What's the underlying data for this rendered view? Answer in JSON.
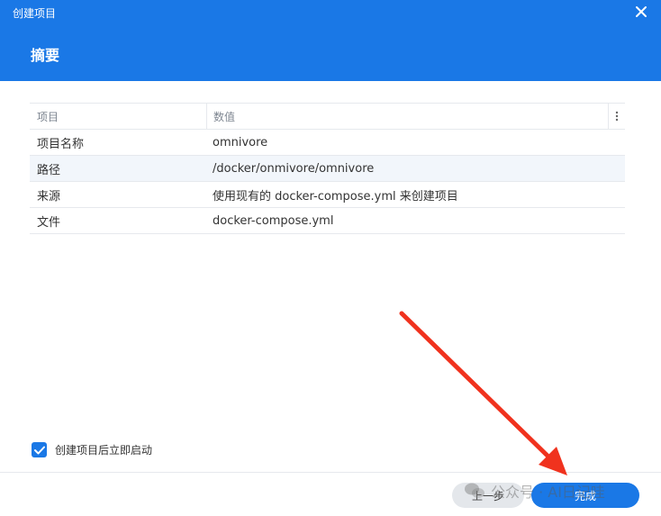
{
  "window": {
    "title": "创建项目",
    "close_icon": "close-icon"
  },
  "step": {
    "title": "摘要"
  },
  "table": {
    "headers": {
      "item": "项目",
      "value": "数值"
    },
    "rows": [
      {
        "item": "项目名称",
        "value": "omnivore"
      },
      {
        "item": "路径",
        "value": "/docker/onmivore/omnivore"
      },
      {
        "item": "来源",
        "value": "使用现有的 docker-compose.yml 来创建项目"
      },
      {
        "item": "文件",
        "value": "docker-compose.yml"
      }
    ]
  },
  "options": {
    "start_after_create_label": "创建项目后立即启动",
    "start_after_create_checked": true
  },
  "footer": {
    "prev_label": "上一步",
    "finish_label": "完成"
  },
  "watermark": {
    "text": "公众号 · AI日记哇"
  },
  "colors": {
    "accent": "#1a78e6",
    "annotation_arrow": "#f0321e"
  }
}
